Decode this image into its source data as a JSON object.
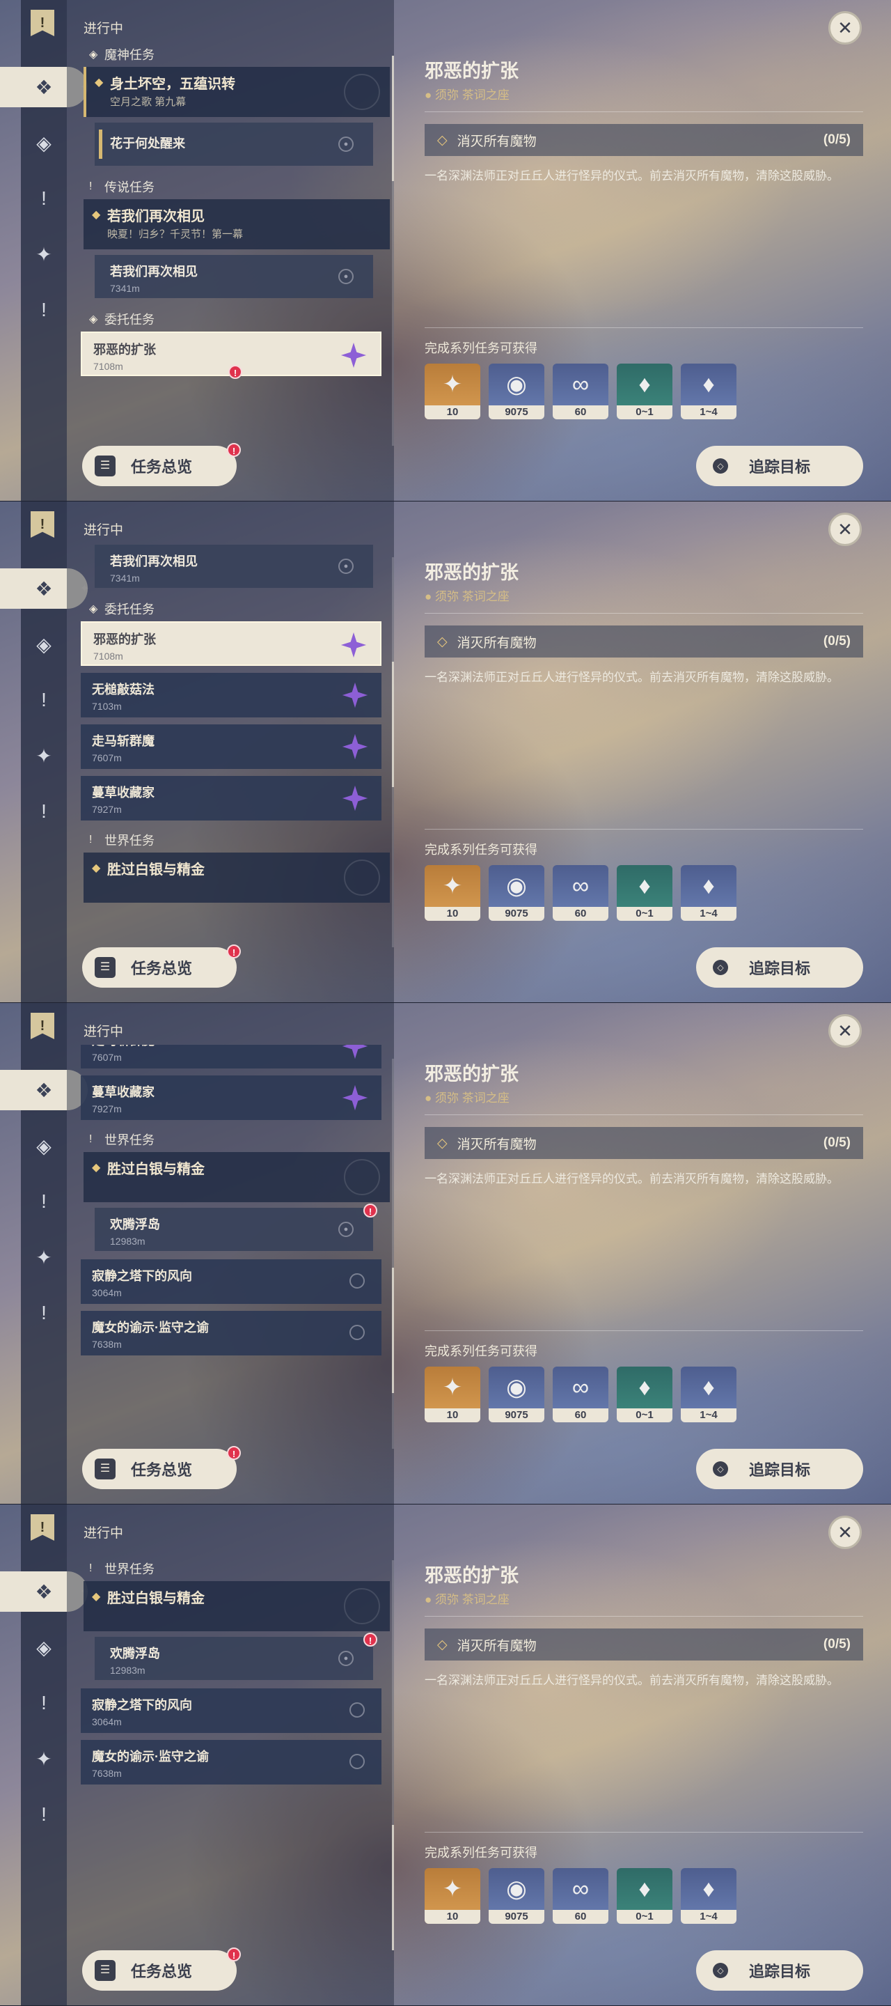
{
  "header": {
    "progress_label": "进行中"
  },
  "detail": {
    "title": "邪恶的扩张",
    "location": "须弥 茶词之座",
    "objective": "消灭所有魔物",
    "objective_count": "(0/5)",
    "description": "一名深渊法师正对丘丘人进行怪异的仪式。前去消灭所有魔物，清除这股威胁。",
    "reward_label": "完成系列任务可获得",
    "rewards": [
      {
        "icon": "primogem-icon",
        "count": "10"
      },
      {
        "icon": "mora-icon",
        "count": "9075"
      },
      {
        "icon": "adventure-exp-icon",
        "count": "60"
      },
      {
        "icon": "crystal-chunk-icon",
        "count": "0~1"
      },
      {
        "icon": "crystal-cluster-icon",
        "count": "1~4"
      }
    ],
    "track_label": "追踪目标"
  },
  "footer": {
    "overview_label": "任务总览",
    "overview_badge": "!"
  },
  "categories": {
    "archon": "魔神任务",
    "legend": "传说任务",
    "commission": "委托任务",
    "world": "世界任务"
  },
  "quests": {
    "archon_main": {
      "title": "身土坏空，五蕴识转",
      "sub": "空月之歌 第九幕"
    },
    "archon_step": {
      "title": "花于何处醒来"
    },
    "legend_main": {
      "title": "若我们再次相见",
      "sub": "映夏！归乡？千灵节！第一幕"
    },
    "legend_step": {
      "title": "若我们再次相见",
      "dist": "7341m"
    },
    "c1": {
      "title": "邪恶的扩张",
      "dist": "7108m"
    },
    "c2": {
      "title": "无槌敲菇法",
      "dist": "7103m"
    },
    "c3": {
      "title": "走马斩群魔",
      "dist": "7607m"
    },
    "c4": {
      "title": "蔓草收藏家",
      "dist": "7927m"
    },
    "world_main": {
      "title": "胜过白银与精金"
    },
    "world_step": {
      "title": "欢腾浮岛",
      "dist": "12983m"
    },
    "w2": {
      "title": "寂静之塔下的风向",
      "dist": "3064m"
    },
    "w3": {
      "title": "魔女的谕示·监守之谕",
      "dist": "7638m"
    }
  }
}
